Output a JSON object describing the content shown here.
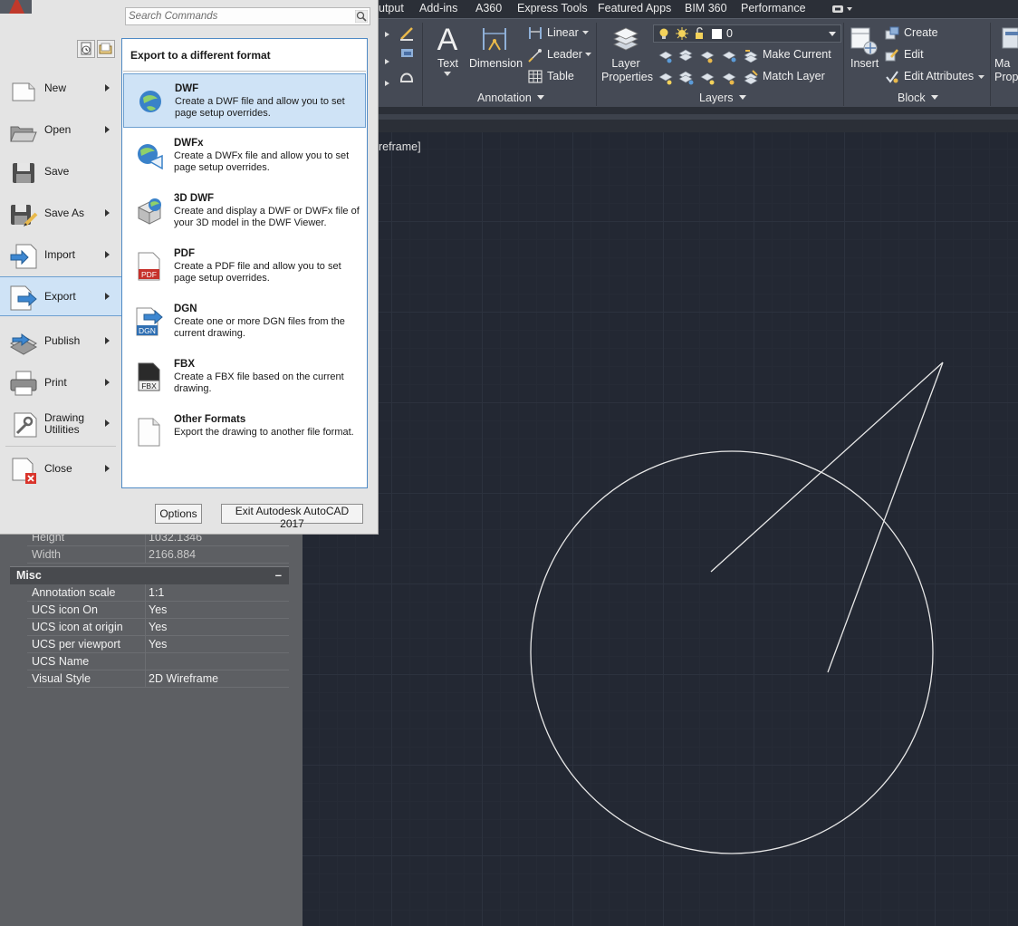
{
  "ribbon": {
    "tabs": [
      "utput",
      "Add-ins",
      "A360",
      "Express Tools",
      "Featured Apps",
      "BIM 360",
      "Performance"
    ],
    "annotation": {
      "text_label": "Text",
      "dimension_label": "Dimension",
      "linear_label": "Linear",
      "leader_label": "Leader",
      "table_label": "Table",
      "panel_title": "Annotation"
    },
    "layers": {
      "layer_properties_label": "Layer\nProperties",
      "current_layer": "0",
      "make_current_label": "Make Current",
      "match_layer_label": "Match Layer",
      "panel_title": "Layers"
    },
    "block": {
      "insert_label": "Insert",
      "create_label": "Create",
      "edit_label": "Edit",
      "edit_attributes_label": "Edit Attributes",
      "panel_title": "Block"
    },
    "cut_label": "Ma\nProp"
  },
  "viewport": {
    "label": "reframe]"
  },
  "app_menu": {
    "search_placeholder": "Search Commands",
    "items": [
      {
        "label": "New",
        "icon": "new-file-icon",
        "arrow": true
      },
      {
        "label": "Open",
        "icon": "open-folder-icon",
        "arrow": true
      },
      {
        "label": "Save",
        "icon": "save-disk-icon",
        "arrow": false
      },
      {
        "label": "Save As",
        "icon": "save-as-icon",
        "arrow": true
      },
      {
        "label": "Import",
        "icon": "import-icon",
        "arrow": true
      },
      {
        "label": "Export",
        "icon": "export-icon",
        "arrow": true,
        "active": true
      },
      {
        "label": "Publish",
        "icon": "publish-icon",
        "arrow": true
      },
      {
        "label": "Print",
        "icon": "printer-icon",
        "arrow": true
      },
      {
        "label": "Drawing\nUtilities",
        "icon": "wrench-icon",
        "arrow": true
      },
      {
        "label": "Close",
        "icon": "close-file-icon",
        "arrow": true
      }
    ],
    "submenu": {
      "title": "Export to a different format",
      "items": [
        {
          "title": "DWF",
          "desc": "Create a DWF file and allow you to set page setup overrides.",
          "icon": "dwf-icon"
        },
        {
          "title": "DWFx",
          "desc": "Create a DWFx file and allow you to set page setup overrides.",
          "icon": "dwfx-icon"
        },
        {
          "title": "3D DWF",
          "desc": "Create and display a DWF or DWFx file of your 3D model in the DWF Viewer.",
          "icon": "3d-dwf-icon"
        },
        {
          "title": "PDF",
          "desc": "Create a PDF file and allow you to set page setup overrides.",
          "icon": "pdf-icon"
        },
        {
          "title": "DGN",
          "desc": "Create one or more DGN files from the current drawing.",
          "icon": "dgn-icon"
        },
        {
          "title": "FBX",
          "desc": "Create a FBX file based on the current drawing.",
          "icon": "fbx-icon"
        },
        {
          "title": "Other Formats",
          "desc": "Export the drawing to another file format.",
          "icon": "other-formats-icon"
        }
      ]
    },
    "options_label": "Options",
    "exit_label": "Exit Autodesk AutoCAD 2017"
  },
  "properties": {
    "height_label": "Height",
    "height_value": "1032.1346",
    "width_label": "Width",
    "width_value": "2166.884",
    "misc_title": "Misc",
    "collapse_symbol": "–",
    "rows": [
      {
        "label": "Annotation scale",
        "value": "1:1"
      },
      {
        "label": "UCS icon On",
        "value": "Yes"
      },
      {
        "label": "UCS icon at origin",
        "value": "Yes"
      },
      {
        "label": "UCS per viewport",
        "value": "Yes"
      },
      {
        "label": "UCS Name",
        "value": ""
      },
      {
        "label": "Visual Style",
        "value": "2D Wireframe"
      }
    ]
  },
  "colors": {
    "drawing_bg": "#232833",
    "ribbon_bg": "#454a55",
    "menu_bg": "#e4e4e4",
    "highlight": "#cfe3f6",
    "accent_border": "#4f8ac5",
    "geometry": "#e8e8e8"
  }
}
